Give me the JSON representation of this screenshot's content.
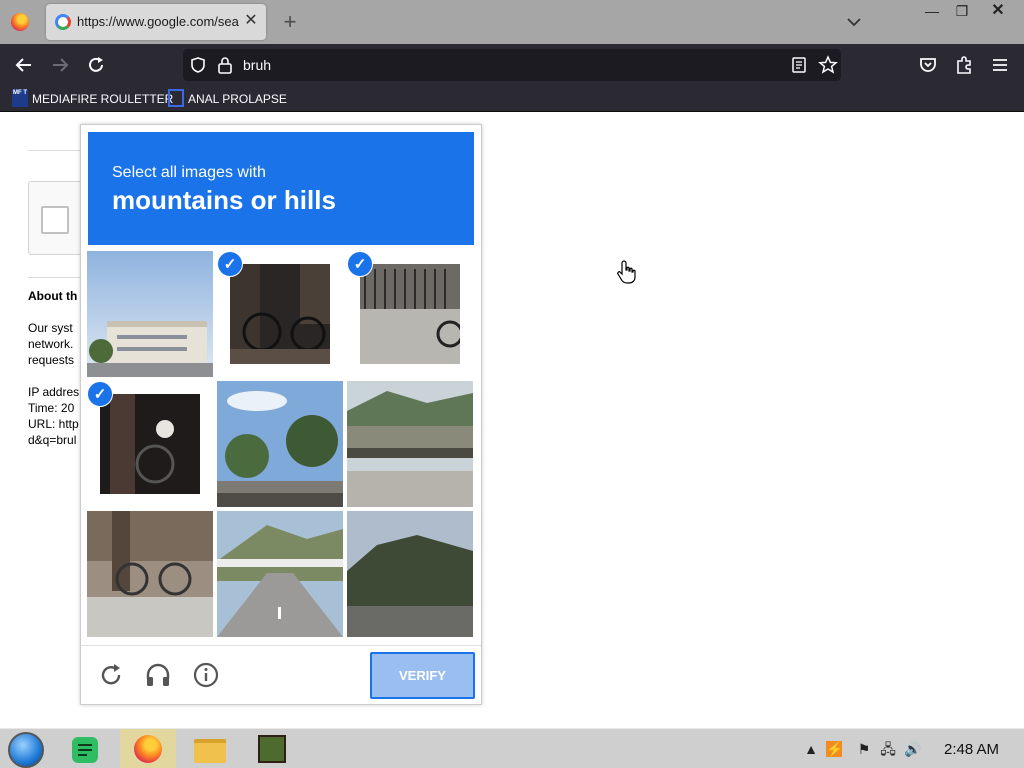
{
  "browser": {
    "tab_title": "https://www.google.com/search?q=bruh",
    "new_tab": "+",
    "tab_close": "✕",
    "url": "bruh",
    "bookmarks": [
      "MEDIAFIRE ROULETTER",
      "ANAL PROLAPSE"
    ],
    "mf_icon_text": "MF T"
  },
  "page": {
    "about_title": "About th",
    "about_lines": [
      "Our syst",
      "network.",
      "requests"
    ],
    "info_lines": [
      "IP addres",
      "Time: 20",
      "URL: http",
      "d&q=brul"
    ]
  },
  "challenge": {
    "instruction": "Select all images with",
    "target": "mountains or hills",
    "verify_label": "VERIFY",
    "tiles": [
      {
        "desc": "building",
        "selected": false
      },
      {
        "desc": "bicycle",
        "selected": true
      },
      {
        "desc": "gate",
        "selected": true
      },
      {
        "desc": "bicycle-tree",
        "selected": true
      },
      {
        "desc": "palm-trees",
        "selected": false
      },
      {
        "desc": "bridge-hills",
        "selected": false
      },
      {
        "desc": "sidewalk-bike",
        "selected": false
      },
      {
        "desc": "road-hills",
        "selected": false
      },
      {
        "desc": "hills",
        "selected": false
      }
    ]
  },
  "taskbar": {
    "clock": "2:48 AM"
  }
}
